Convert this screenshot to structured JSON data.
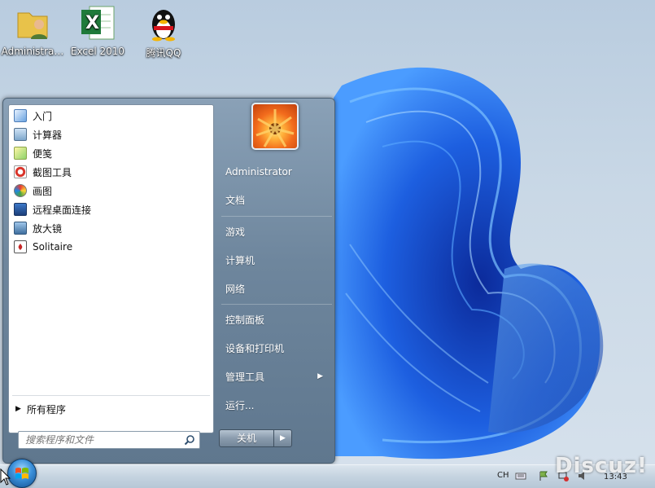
{
  "desktop": {
    "icons": [
      {
        "label": "Administra…",
        "icon": "user-folder-icon"
      },
      {
        "label": "Excel 2010",
        "icon": "excel-icon"
      },
      {
        "label": "腾讯QQ",
        "icon": "qq-penguin-icon"
      }
    ]
  },
  "start_menu": {
    "programs": [
      {
        "label": "入门",
        "icon": "getting-started-icon"
      },
      {
        "label": "计算器",
        "icon": "calculator-icon"
      },
      {
        "label": "便笺",
        "icon": "sticky-notes-icon"
      },
      {
        "label": "截图工具",
        "icon": "snipping-tool-icon"
      },
      {
        "label": "画图",
        "icon": "paint-icon"
      },
      {
        "label": "远程桌面连接",
        "icon": "remote-desktop-icon"
      },
      {
        "label": "放大镜",
        "icon": "magnifier-icon"
      },
      {
        "label": "Solitaire",
        "icon": "solitaire-icon"
      }
    ],
    "all_programs_label": "所有程序",
    "search": {
      "placeholder": "搜索程序和文件",
      "value": ""
    },
    "right_items": [
      {
        "label": "Administrator"
      },
      {
        "label": "文档"
      },
      {
        "label": "游戏"
      },
      {
        "label": "计算机"
      },
      {
        "label": "网络"
      },
      {
        "label": "控制面板"
      },
      {
        "label": "设备和打印机"
      },
      {
        "label": "管理工具"
      },
      {
        "label": "运行..."
      }
    ],
    "shutdown_label": "关机"
  },
  "taskbar": {
    "language": "CH",
    "clock": "13:43"
  },
  "watermark": "Discuz!",
  "colors": {
    "accent": "#1f5fd6",
    "menu_body": "#6e869d"
  }
}
